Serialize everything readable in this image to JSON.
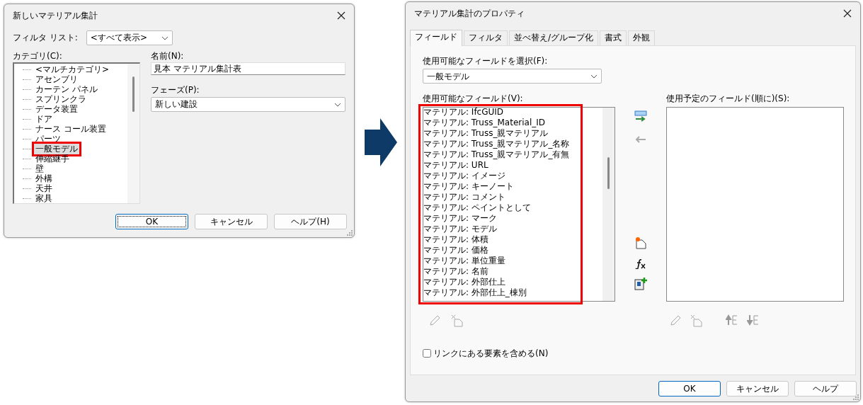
{
  "new_schedule_dialog": {
    "title": "新しいマテリアル集計",
    "filter_label": "フィルタ リスト:",
    "filter_value": "<すべて表示>",
    "category_label": "カテゴリ(C):",
    "categories": [
      {
        "label": "<マルチカテゴリ>",
        "selected": false,
        "highlighted": false
      },
      {
        "label": "アセンブリ",
        "selected": false,
        "highlighted": false
      },
      {
        "label": "カーテン パネル",
        "selected": false,
        "highlighted": false
      },
      {
        "label": "スプリンクラ",
        "selected": false,
        "highlighted": false
      },
      {
        "label": "データ装置",
        "selected": false,
        "highlighted": false
      },
      {
        "label": "ドア",
        "selected": false,
        "highlighted": false
      },
      {
        "label": "ナース コール装置",
        "selected": false,
        "highlighted": false
      },
      {
        "label": "パーツ",
        "selected": false,
        "highlighted": false
      },
      {
        "label": "一般モデル",
        "selected": true,
        "highlighted": true
      },
      {
        "label": "伸縮継手",
        "selected": false,
        "highlighted": false
      },
      {
        "label": "壁",
        "selected": false,
        "highlighted": false
      },
      {
        "label": "外構",
        "selected": false,
        "highlighted": false
      },
      {
        "label": "天井",
        "selected": false,
        "highlighted": false
      },
      {
        "label": "家具",
        "selected": false,
        "highlighted": false
      }
    ],
    "name_label": "名前(N):",
    "name_value": "見本 マテリアル集計表",
    "phase_label": "フェーズ(P):",
    "phase_value": "新しい建設",
    "buttons": [
      {
        "label": "OK",
        "default": true
      },
      {
        "label": "キャンセル",
        "default": false
      },
      {
        "label": "ヘルプ(H)",
        "default": false
      }
    ]
  },
  "properties_dialog": {
    "title": "マテリアル集計のプロパティ",
    "tabs": [
      {
        "label": "フィールド",
        "selected": true
      },
      {
        "label": "フィルタ",
        "selected": false
      },
      {
        "label": "並べ替え/グループ化",
        "selected": false
      },
      {
        "label": "書式",
        "selected": false
      },
      {
        "label": "外観",
        "selected": false
      }
    ],
    "select_label": "使用可能なフィールドを選択(F):",
    "select_value": "一般モデル",
    "available_label": "使用可能なフィールド(V):",
    "available_highlighted": true,
    "available_fields": [
      "マテリアル: IfcGUID",
      "マテリアル: Truss_Material_ID",
      "マテリアル: Truss_親マテリアル",
      "マテリアル: Truss_親マテリアル_名称",
      "マテリアル: Truss_親マテリアル_有無",
      "マテリアル: URL",
      "マテリアル: イメージ",
      "マテリアル: キーノート",
      "マテリアル: コメント",
      "マテリアル: ペイントとして",
      "マテリアル: マーク",
      "マテリアル: モデル",
      "マテリアル: 体積",
      "マテリアル: 価格",
      "マテリアル: 単位重量",
      "マテリアル: 名前",
      "マテリアル: 外部仕上",
      "マテリアル: 外部仕上_棟別"
    ],
    "scheduled_label": "使用予定のフィールド(順に)(S):",
    "include_linked": {
      "label": "リンクにある要素を含める(N)",
      "checked": false
    },
    "buttons": [
      {
        "label": "OK",
        "default": true
      },
      {
        "label": "キャンセル",
        "default": false
      },
      {
        "label": "ヘルプ",
        "default": false
      }
    ]
  }
}
